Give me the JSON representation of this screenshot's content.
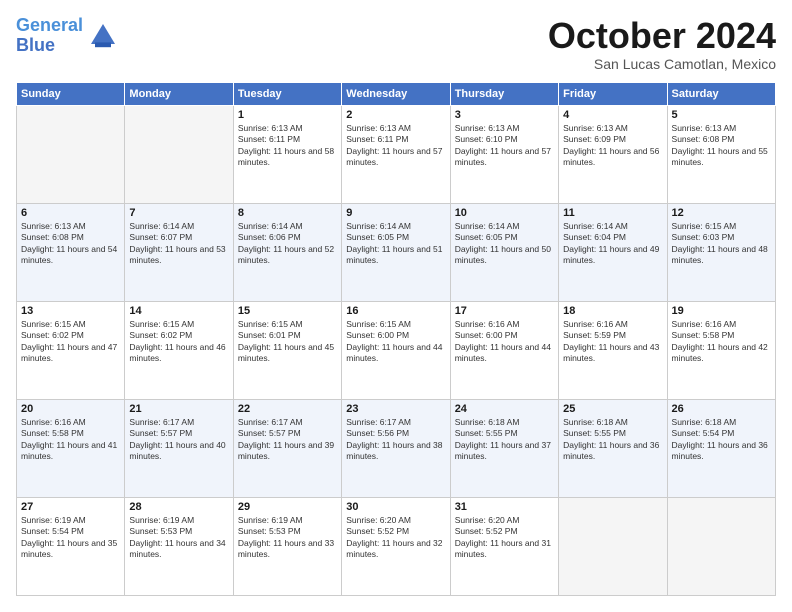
{
  "logo": {
    "line1": "General",
    "line2": "Blue"
  },
  "title": "October 2024",
  "subtitle": "San Lucas Camotlan, Mexico",
  "days_of_week": [
    "Sunday",
    "Monday",
    "Tuesday",
    "Wednesday",
    "Thursday",
    "Friday",
    "Saturday"
  ],
  "weeks": [
    [
      {
        "day": "",
        "empty": true
      },
      {
        "day": "",
        "empty": true
      },
      {
        "day": "1",
        "sunrise": "Sunrise: 6:13 AM",
        "sunset": "Sunset: 6:11 PM",
        "daylight": "Daylight: 11 hours and 58 minutes."
      },
      {
        "day": "2",
        "sunrise": "Sunrise: 6:13 AM",
        "sunset": "Sunset: 6:11 PM",
        "daylight": "Daylight: 11 hours and 57 minutes."
      },
      {
        "day": "3",
        "sunrise": "Sunrise: 6:13 AM",
        "sunset": "Sunset: 6:10 PM",
        "daylight": "Daylight: 11 hours and 57 minutes."
      },
      {
        "day": "4",
        "sunrise": "Sunrise: 6:13 AM",
        "sunset": "Sunset: 6:09 PM",
        "daylight": "Daylight: 11 hours and 56 minutes."
      },
      {
        "day": "5",
        "sunrise": "Sunrise: 6:13 AM",
        "sunset": "Sunset: 6:08 PM",
        "daylight": "Daylight: 11 hours and 55 minutes."
      }
    ],
    [
      {
        "day": "6",
        "sunrise": "Sunrise: 6:13 AM",
        "sunset": "Sunset: 6:08 PM",
        "daylight": "Daylight: 11 hours and 54 minutes."
      },
      {
        "day": "7",
        "sunrise": "Sunrise: 6:14 AM",
        "sunset": "Sunset: 6:07 PM",
        "daylight": "Daylight: 11 hours and 53 minutes."
      },
      {
        "day": "8",
        "sunrise": "Sunrise: 6:14 AM",
        "sunset": "Sunset: 6:06 PM",
        "daylight": "Daylight: 11 hours and 52 minutes."
      },
      {
        "day": "9",
        "sunrise": "Sunrise: 6:14 AM",
        "sunset": "Sunset: 6:05 PM",
        "daylight": "Daylight: 11 hours and 51 minutes."
      },
      {
        "day": "10",
        "sunrise": "Sunrise: 6:14 AM",
        "sunset": "Sunset: 6:05 PM",
        "daylight": "Daylight: 11 hours and 50 minutes."
      },
      {
        "day": "11",
        "sunrise": "Sunrise: 6:14 AM",
        "sunset": "Sunset: 6:04 PM",
        "daylight": "Daylight: 11 hours and 49 minutes."
      },
      {
        "day": "12",
        "sunrise": "Sunrise: 6:15 AM",
        "sunset": "Sunset: 6:03 PM",
        "daylight": "Daylight: 11 hours and 48 minutes."
      }
    ],
    [
      {
        "day": "13",
        "sunrise": "Sunrise: 6:15 AM",
        "sunset": "Sunset: 6:02 PM",
        "daylight": "Daylight: 11 hours and 47 minutes."
      },
      {
        "day": "14",
        "sunrise": "Sunrise: 6:15 AM",
        "sunset": "Sunset: 6:02 PM",
        "daylight": "Daylight: 11 hours and 46 minutes."
      },
      {
        "day": "15",
        "sunrise": "Sunrise: 6:15 AM",
        "sunset": "Sunset: 6:01 PM",
        "daylight": "Daylight: 11 hours and 45 minutes."
      },
      {
        "day": "16",
        "sunrise": "Sunrise: 6:15 AM",
        "sunset": "Sunset: 6:00 PM",
        "daylight": "Daylight: 11 hours and 44 minutes."
      },
      {
        "day": "17",
        "sunrise": "Sunrise: 6:16 AM",
        "sunset": "Sunset: 6:00 PM",
        "daylight": "Daylight: 11 hours and 44 minutes."
      },
      {
        "day": "18",
        "sunrise": "Sunrise: 6:16 AM",
        "sunset": "Sunset: 5:59 PM",
        "daylight": "Daylight: 11 hours and 43 minutes."
      },
      {
        "day": "19",
        "sunrise": "Sunrise: 6:16 AM",
        "sunset": "Sunset: 5:58 PM",
        "daylight": "Daylight: 11 hours and 42 minutes."
      }
    ],
    [
      {
        "day": "20",
        "sunrise": "Sunrise: 6:16 AM",
        "sunset": "Sunset: 5:58 PM",
        "daylight": "Daylight: 11 hours and 41 minutes."
      },
      {
        "day": "21",
        "sunrise": "Sunrise: 6:17 AM",
        "sunset": "Sunset: 5:57 PM",
        "daylight": "Daylight: 11 hours and 40 minutes."
      },
      {
        "day": "22",
        "sunrise": "Sunrise: 6:17 AM",
        "sunset": "Sunset: 5:57 PM",
        "daylight": "Daylight: 11 hours and 39 minutes."
      },
      {
        "day": "23",
        "sunrise": "Sunrise: 6:17 AM",
        "sunset": "Sunset: 5:56 PM",
        "daylight": "Daylight: 11 hours and 38 minutes."
      },
      {
        "day": "24",
        "sunrise": "Sunrise: 6:18 AM",
        "sunset": "Sunset: 5:55 PM",
        "daylight": "Daylight: 11 hours and 37 minutes."
      },
      {
        "day": "25",
        "sunrise": "Sunrise: 6:18 AM",
        "sunset": "Sunset: 5:55 PM",
        "daylight": "Daylight: 11 hours and 36 minutes."
      },
      {
        "day": "26",
        "sunrise": "Sunrise: 6:18 AM",
        "sunset": "Sunset: 5:54 PM",
        "daylight": "Daylight: 11 hours and 36 minutes."
      }
    ],
    [
      {
        "day": "27",
        "sunrise": "Sunrise: 6:19 AM",
        "sunset": "Sunset: 5:54 PM",
        "daylight": "Daylight: 11 hours and 35 minutes."
      },
      {
        "day": "28",
        "sunrise": "Sunrise: 6:19 AM",
        "sunset": "Sunset: 5:53 PM",
        "daylight": "Daylight: 11 hours and 34 minutes."
      },
      {
        "day": "29",
        "sunrise": "Sunrise: 6:19 AM",
        "sunset": "Sunset: 5:53 PM",
        "daylight": "Daylight: 11 hours and 33 minutes."
      },
      {
        "day": "30",
        "sunrise": "Sunrise: 6:20 AM",
        "sunset": "Sunset: 5:52 PM",
        "daylight": "Daylight: 11 hours and 32 minutes."
      },
      {
        "day": "31",
        "sunrise": "Sunrise: 6:20 AM",
        "sunset": "Sunset: 5:52 PM",
        "daylight": "Daylight: 11 hours and 31 minutes."
      },
      {
        "day": "",
        "empty": true
      },
      {
        "day": "",
        "empty": true
      }
    ]
  ]
}
